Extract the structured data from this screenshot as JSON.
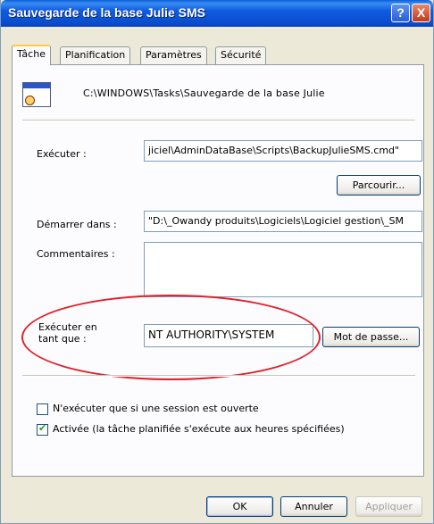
{
  "window": {
    "title": "Sauvegarde de la base Julie SMS",
    "help_label": "?",
    "close_label": "X"
  },
  "tabs": [
    {
      "label": "Tâche",
      "active": true
    },
    {
      "label": "Planification",
      "active": false
    },
    {
      "label": "Paramètres",
      "active": false
    },
    {
      "label": "Sécurité",
      "active": false
    }
  ],
  "task": {
    "path": "C:\\WINDOWS\\Tasks\\Sauvegarde de la base Julie"
  },
  "executer": {
    "label": "Exécuter :",
    "value": "jiciel\\AdminDataBase\\Scripts\\BackupJulieSMS.cmd\""
  },
  "browse_button": "Parcourir...",
  "demarrer": {
    "label": "Démarrer dans :",
    "value": "\"D:\\_Owandy produits\\Logiciels\\Logiciel gestion\\_SM"
  },
  "commentaires": {
    "label": "Commentaires :",
    "value": ""
  },
  "executer_en_tant": {
    "label_line1": "Exécuter en",
    "label_line2": "tant que :",
    "value": "NT AUTHORITY\\SYSTEM"
  },
  "password_button": "Mot de passe...",
  "options": [
    {
      "label": "N'exécuter que si une session est ouverte",
      "checked": false
    },
    {
      "label": "Activée (la tâche planifiée s'exécute aux heures spécifiées)",
      "checked": true
    }
  ],
  "footer": {
    "ok": "OK",
    "cancel": "Annuler",
    "apply": "Appliquer"
  },
  "colors": {
    "title_bar": "#0a5fd6",
    "highlight_ellipse": "#e0202a",
    "window_bg": "#ece9d8"
  }
}
